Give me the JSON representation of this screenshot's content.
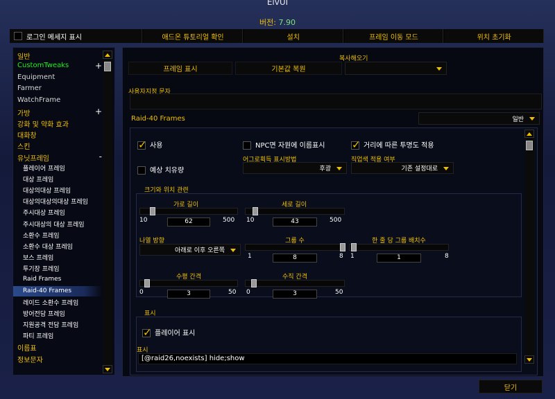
{
  "app": {
    "title": "ElvUI",
    "version_label": "버전:",
    "version_value": "7.90"
  },
  "topbar": {
    "login_msg": "로그인 메세지 표시",
    "tutorial": "애드온 튜토리얼 확인",
    "install": "설치",
    "move_mode": "프레임 이동 모드",
    "reset_pos": "위치 초기화"
  },
  "sidebar": {
    "items": [
      {
        "label": "일반"
      },
      {
        "label": "CustomTweaks"
      },
      {
        "label": "Equipment"
      },
      {
        "label": "Farmer"
      },
      {
        "label": "WatchFrame"
      },
      {
        "label": "가방"
      },
      {
        "label": "강화 및 약화 효과"
      },
      {
        "label": "대화창"
      },
      {
        "label": "스킨"
      },
      {
        "label": "유닛프레임"
      },
      {
        "label": "플레이어 프레임"
      },
      {
        "label": "대상 프레임"
      },
      {
        "label": "대상의대상 프레임"
      },
      {
        "label": "대상의대상의대상 프레임"
      },
      {
        "label": "주시대상 프레임"
      },
      {
        "label": "주시대상의 대상 프레임"
      },
      {
        "label": "소환수 프레임"
      },
      {
        "label": "소환수 대상 프레임"
      },
      {
        "label": "보스 프레임"
      },
      {
        "label": "투기장 프레임"
      },
      {
        "label": "Raid Frames"
      },
      {
        "label": "Raid-40 Frames"
      },
      {
        "label": "레이드 소환수 프레임"
      },
      {
        "label": "방어전담 프레임"
      },
      {
        "label": "지원공격 전담 프레임"
      },
      {
        "label": "파티 프레임"
      },
      {
        "label": "이름표"
      },
      {
        "label": "정보문자"
      }
    ],
    "plus": "+",
    "minus": "-"
  },
  "main": {
    "copy_label": "복사해오기",
    "show_frame": "프레임 표시",
    "restore_default": "기본값 복원",
    "copy_value": "",
    "custom_text_label": "사용자지정 문자",
    "custom_text_value": "",
    "group_title": "Raid-40 Frames",
    "group_dropdown": "일반",
    "enable": "사용",
    "npc_name": "NPC면 자원에 이름표시",
    "range_fade": "거리에 따른 투명도 적용",
    "aggro_label": "어그로획득 표시방법",
    "aggro_value": "후광",
    "class_color_label": "직업색 적용 여부",
    "class_color_value": "기존 설정대로",
    "heal_predict": "예상 치유량",
    "size_section": "크기와 위치 관련",
    "width_label": "가로 길이",
    "width_value": "62",
    "width_min": "10",
    "width_max": "500",
    "height_label": "세로 길이",
    "height_value": "43",
    "height_min": "10",
    "height_max": "500",
    "growth_label": "나열 방향",
    "growth_value": "아래로 이후 오른쪽",
    "groups_label": "그룹 수",
    "groups_value": "8",
    "groups_min": "1",
    "groups_max": "8",
    "per_row_label": "한 줄 당 그룹 배치수",
    "per_row_value": "1",
    "per_row_min": "1",
    "per_row_max": "8",
    "hspace_label": "수평 간격",
    "hspace_value": "3",
    "hspace_min": "0",
    "hspace_max": "50",
    "vspace_label": "수직 간격",
    "vspace_value": "3",
    "vspace_min": "0",
    "vspace_max": "50",
    "display_section": "표시",
    "show_player": "플레이어 표시",
    "visibility_label": "표시",
    "visibility_value": "[@raid26,noexists] hide;show"
  },
  "close": "닫기",
  "colors": {
    "accent": "#f0c000",
    "version": "#7fe07f",
    "green": "#22ee22"
  }
}
